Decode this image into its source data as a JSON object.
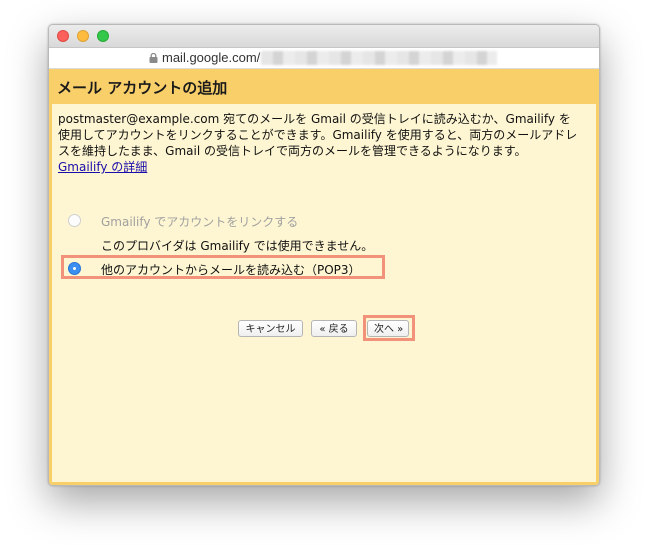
{
  "browser": {
    "url": "mail.google.com/",
    "url_blurred": true
  },
  "dialog": {
    "title": "メール アカウントの追加",
    "description": "postmaster@example.com 宛てのメールを Gmail の受信トレイに読み込むか、Gmailify を使用してアカウントをリンクすることができます。Gmailify を使用すると、両方のメールアドレスを維持したまま、Gmail の受信トレイで両方のメールを管理できるようになります。",
    "learn_more_link": "Gmailify の詳細",
    "options": [
      {
        "label": "Gmailify でアカウントをリンクする",
        "selected": false,
        "disabled": true
      },
      {
        "label": "他のアカウントからメールを読み込む（POP3）",
        "selected": true,
        "disabled": false
      }
    ],
    "note": "このプロバイダは Gmailify では使用できません。"
  },
  "buttons": {
    "cancel": "キャンセル",
    "back": "« 戻る",
    "next": "次へ »"
  },
  "colors": {
    "header_bg": "#f9cf6a",
    "content_bg": "#fef6d2",
    "highlight": "#f2927a",
    "radio_selected": "#3b8ff0",
    "link": "#1a0dab"
  },
  "icons": {
    "window_controls": [
      "close-icon",
      "minimize-icon",
      "maximize-icon"
    ],
    "address_lock": "lock-icon"
  }
}
